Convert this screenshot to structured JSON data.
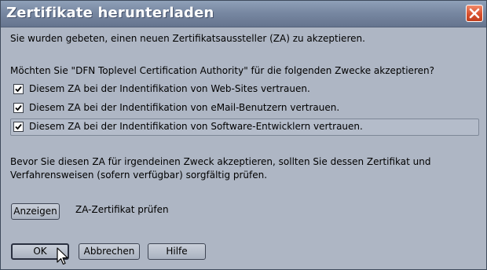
{
  "window": {
    "title": "Zertifikate herunterladen"
  },
  "intro": "Sie wurden gebeten, einen neuen Zertifikatsaussteller (ZA) zu akzeptieren.",
  "question": "Möchten Sie \"DFN Toplevel Certification Authority\" für die folgenden Zwecke akzeptieren?",
  "options": [
    {
      "label": "Diesem ZA bei der Indentifikation von Web-Sites vertrauen.",
      "checked": true
    },
    {
      "label": "Diesem ZA bei der Indentifikation von eMail-Benutzern vertrauen.",
      "checked": true
    },
    {
      "label": "Diesem ZA bei der Indentifikation von Software-Entwicklern vertrauen.",
      "checked": true
    }
  ],
  "advice_line1": "Bevor Sie diesen ZA für irgendeinen Zweck akzeptieren, sollten Sie dessen Zertifikat und",
  "advice_line2": "Verfahrensweisen (sofern verfügbar) sorgfältig prüfen.",
  "view": {
    "button_label": "Anzeigen",
    "caption": "ZA-Zertifikat prüfen"
  },
  "buttons": {
    "ok": "OK",
    "cancel": "Abbrechen",
    "help": "Hilfe"
  },
  "colors": {
    "dialog_bg": "#aeb6c4",
    "titlebar": "#7888a2",
    "close": "#d9502e"
  }
}
